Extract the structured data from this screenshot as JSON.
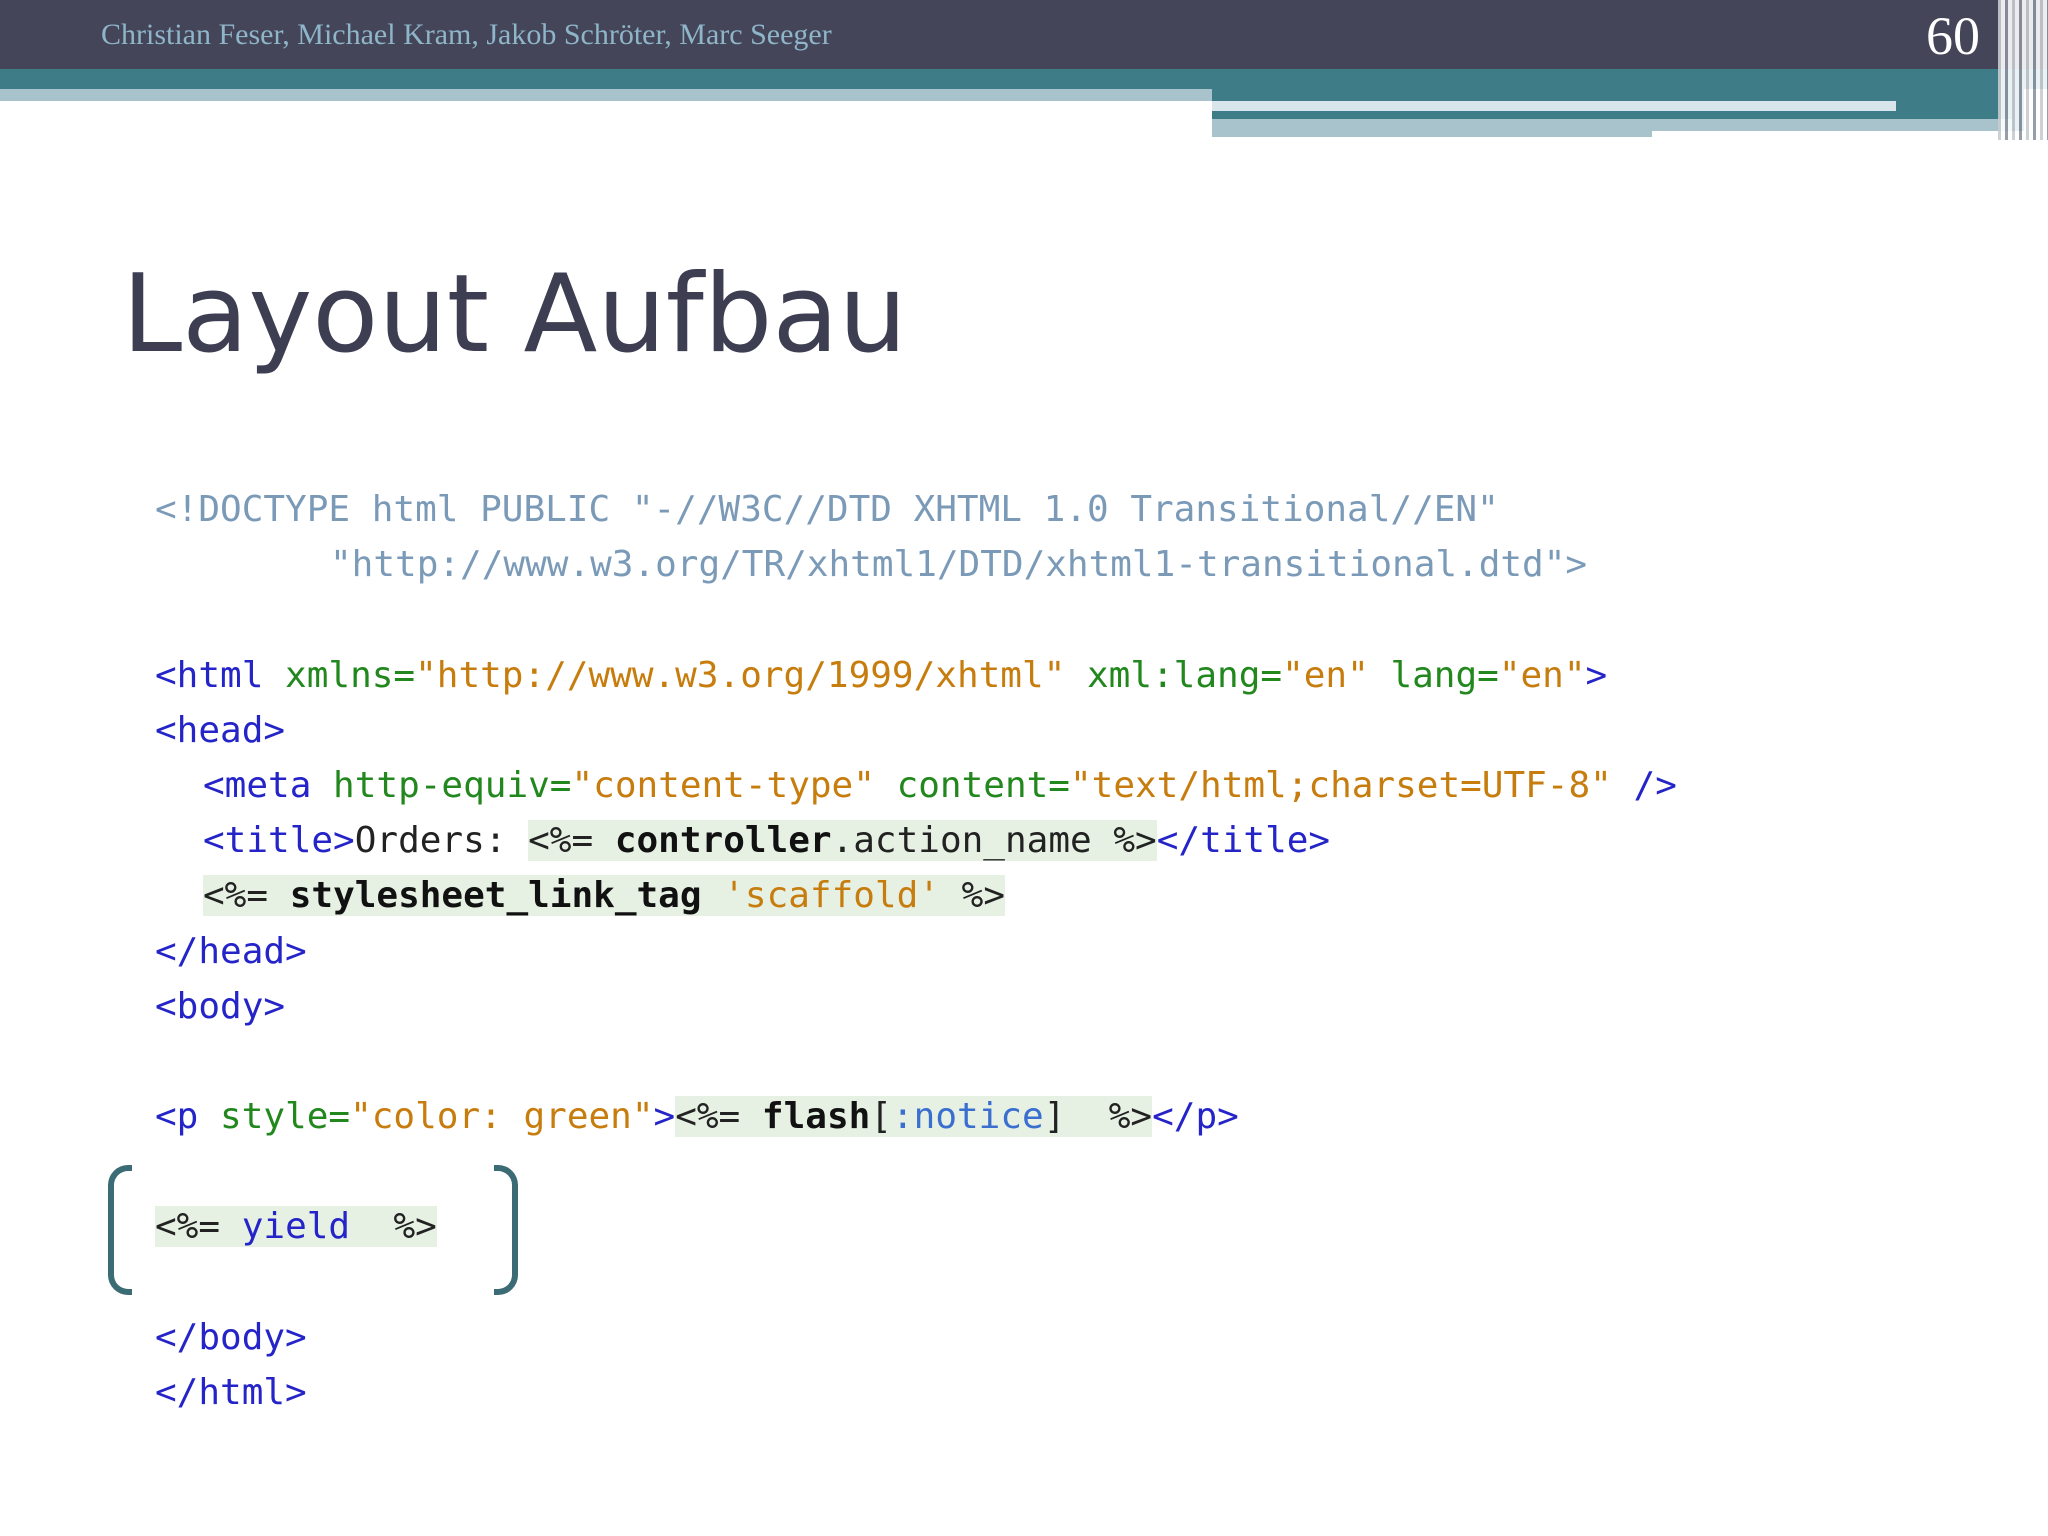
{
  "header": {
    "authors": "Christian Feser, Michael Kram, Jakob Schröter, Marc Seeger",
    "page_number": "60"
  },
  "slide": {
    "title": "Layout Aufbau"
  },
  "code": {
    "doctype_1": "<!DOCTYPE html PUBLIC \"-//W3C//DTD XHTML 1.0 Transitional//EN\"",
    "doctype_2": "\"http://www.w3.org/TR/xhtml1/DTD/xhtml1-transitional.dtd\">",
    "html_open": "<html",
    "xmlns_attr": " xmlns=",
    "xmlns_val": "\"http://www.w3.org/1999/xhtml\"",
    "xmllang_attr": " xml:lang=",
    "xmllang_val": "\"en\"",
    "lang_attr": " lang=",
    "lang_val": "\"en\"",
    "html_close_bracket": ">",
    "head_open": "<head>",
    "meta_open": "<meta",
    "httpequiv_attr": " http-equiv=",
    "httpequiv_val": "\"content-type\"",
    "content_attr": " content=",
    "content_val": "\"text/html;charset=UTF-8\"",
    "meta_close": " />",
    "title_open": "<title>",
    "title_text": "Orders: ",
    "erb_open_eq": "<%=",
    "controller": "controller",
    "action_name": ".action_name",
    "erb_close": "%>",
    "title_close": "</title>",
    "stylesheet_fn": "stylesheet_link_tag",
    "scaffold_val": "'scaffold'",
    "head_close": "</head>",
    "body_open": "<body>",
    "p_open": "<p",
    "style_attr": " style=",
    "style_val_a": "\"color: ",
    "style_val_b": "green\"",
    "p_bracket": ">",
    "flash_fn": "flash",
    "flash_lb": "[",
    "notice_sym": ":notice",
    "flash_rb": "]",
    "p_close": "</p>",
    "yield_kw": "yield",
    "body_close": "</body>",
    "html_close": "</html>"
  }
}
